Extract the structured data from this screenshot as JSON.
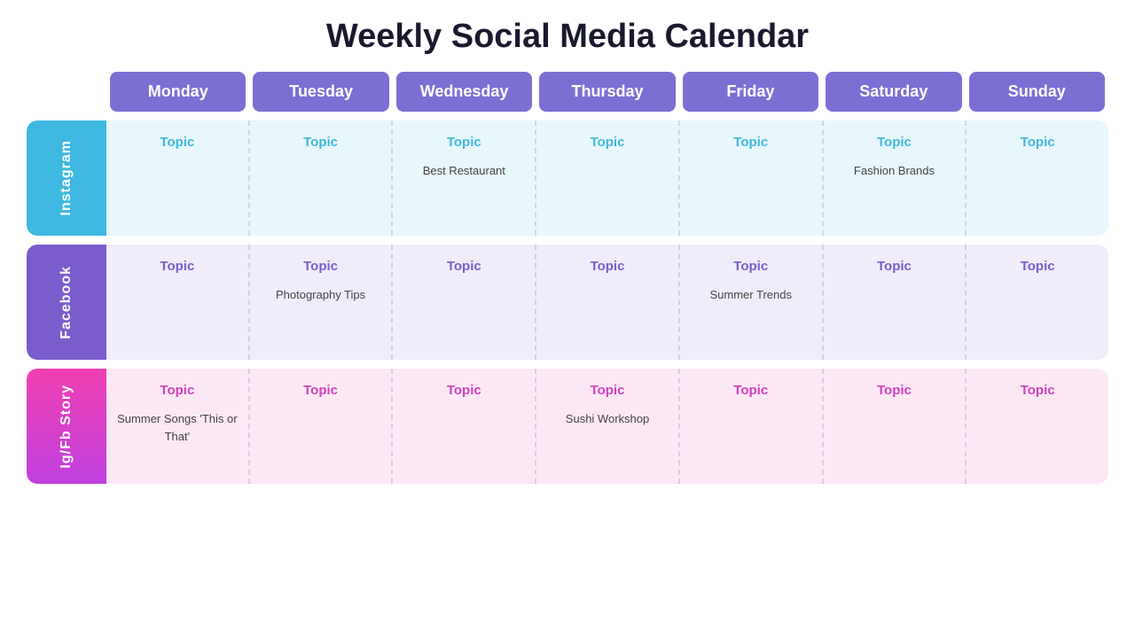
{
  "title": "Weekly Social Media Calendar",
  "days": [
    {
      "label": "Monday",
      "color": "#7c6fd4"
    },
    {
      "label": "Tuesday",
      "color": "#7c6fd4"
    },
    {
      "label": "Wednesday",
      "color": "#7c6fd4"
    },
    {
      "label": "Thursday",
      "color": "#7c6fd4"
    },
    {
      "label": "Friday",
      "color": "#7c6fd4"
    },
    {
      "label": "Saturday",
      "color": "#7c6fd4"
    },
    {
      "label": "Sunday",
      "color": "#7c6fd4"
    }
  ],
  "sections": [
    {
      "name": "Instagram",
      "labelClass": "instagram-label",
      "bgClass": "instagram-bg",
      "topicClass": "instagram-topic",
      "cells": [
        {
          "topic": "Topic",
          "content": ""
        },
        {
          "topic": "Topic",
          "content": ""
        },
        {
          "topic": "Topic",
          "content": "Best Restaurant"
        },
        {
          "topic": "Topic",
          "content": ""
        },
        {
          "topic": "Topic",
          "content": ""
        },
        {
          "topic": "Topic",
          "content": "Fashion Brands"
        },
        {
          "topic": "Topic",
          "content": ""
        }
      ]
    },
    {
      "name": "Facebook",
      "labelClass": "facebook-label",
      "bgClass": "facebook-bg",
      "topicClass": "facebook-topic",
      "cells": [
        {
          "topic": "Topic",
          "content": ""
        },
        {
          "topic": "Topic",
          "content": "Photography Tips"
        },
        {
          "topic": "Topic",
          "content": ""
        },
        {
          "topic": "Topic",
          "content": ""
        },
        {
          "topic": "Topic",
          "content": "Summer Trends"
        },
        {
          "topic": "Topic",
          "content": ""
        },
        {
          "topic": "Topic",
          "content": ""
        }
      ]
    },
    {
      "name": "Ig/Fb Story",
      "labelClass": "story-label",
      "bgClass": "story-bg",
      "topicClass": "story-topic",
      "cells": [
        {
          "topic": "Topic",
          "content": "Summer Songs\n'This or That'"
        },
        {
          "topic": "Topic",
          "content": ""
        },
        {
          "topic": "Topic",
          "content": ""
        },
        {
          "topic": "Topic",
          "content": "Sushi Workshop"
        },
        {
          "topic": "Topic",
          "content": ""
        },
        {
          "topic": "Topic",
          "content": ""
        },
        {
          "topic": "Topic",
          "content": ""
        }
      ]
    }
  ]
}
